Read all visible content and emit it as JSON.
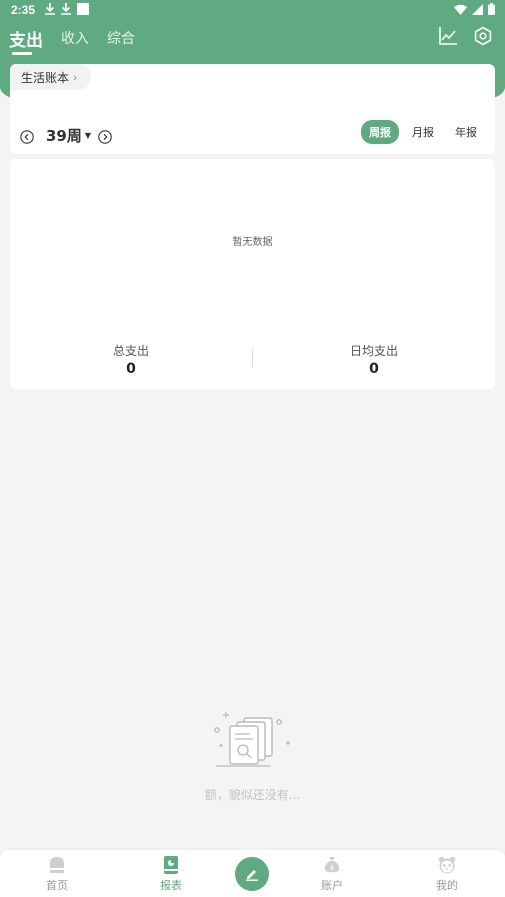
{
  "status_bar": {
    "time": "2:35"
  },
  "header": {
    "tabs": [
      {
        "label": "支出",
        "active": true
      },
      {
        "label": "收入",
        "active": false
      },
      {
        "label": "综合",
        "active": false
      }
    ],
    "icons": [
      "trend-chart-icon",
      "settings-icon"
    ]
  },
  "filter": {
    "book_name": "生活账本",
    "week_label": "39周",
    "period_tabs": [
      {
        "label": "周报",
        "active": true
      },
      {
        "label": "月报",
        "active": false
      },
      {
        "label": "年报",
        "active": false
      }
    ]
  },
  "chart": {
    "empty_text": "暂无数据",
    "total_label": "总支出",
    "total_value": "0",
    "daily_avg_label": "日均支出",
    "daily_avg_value": "0"
  },
  "list": {
    "empty_text": "额，貌似还没有..."
  },
  "bottom_nav": {
    "items": [
      {
        "label": "首页",
        "icon": "home-icon",
        "active": false
      },
      {
        "label": "报表",
        "icon": "report-icon",
        "active": true
      },
      {
        "label": "",
        "icon": "edit-pen-icon",
        "active": false
      },
      {
        "label": "账户",
        "icon": "money-bag-icon",
        "active": false
      },
      {
        "label": "我的",
        "icon": "panda-face-icon",
        "active": false
      }
    ]
  },
  "colors": {
    "primary": "#5faa80",
    "background": "#f4f4f4"
  }
}
